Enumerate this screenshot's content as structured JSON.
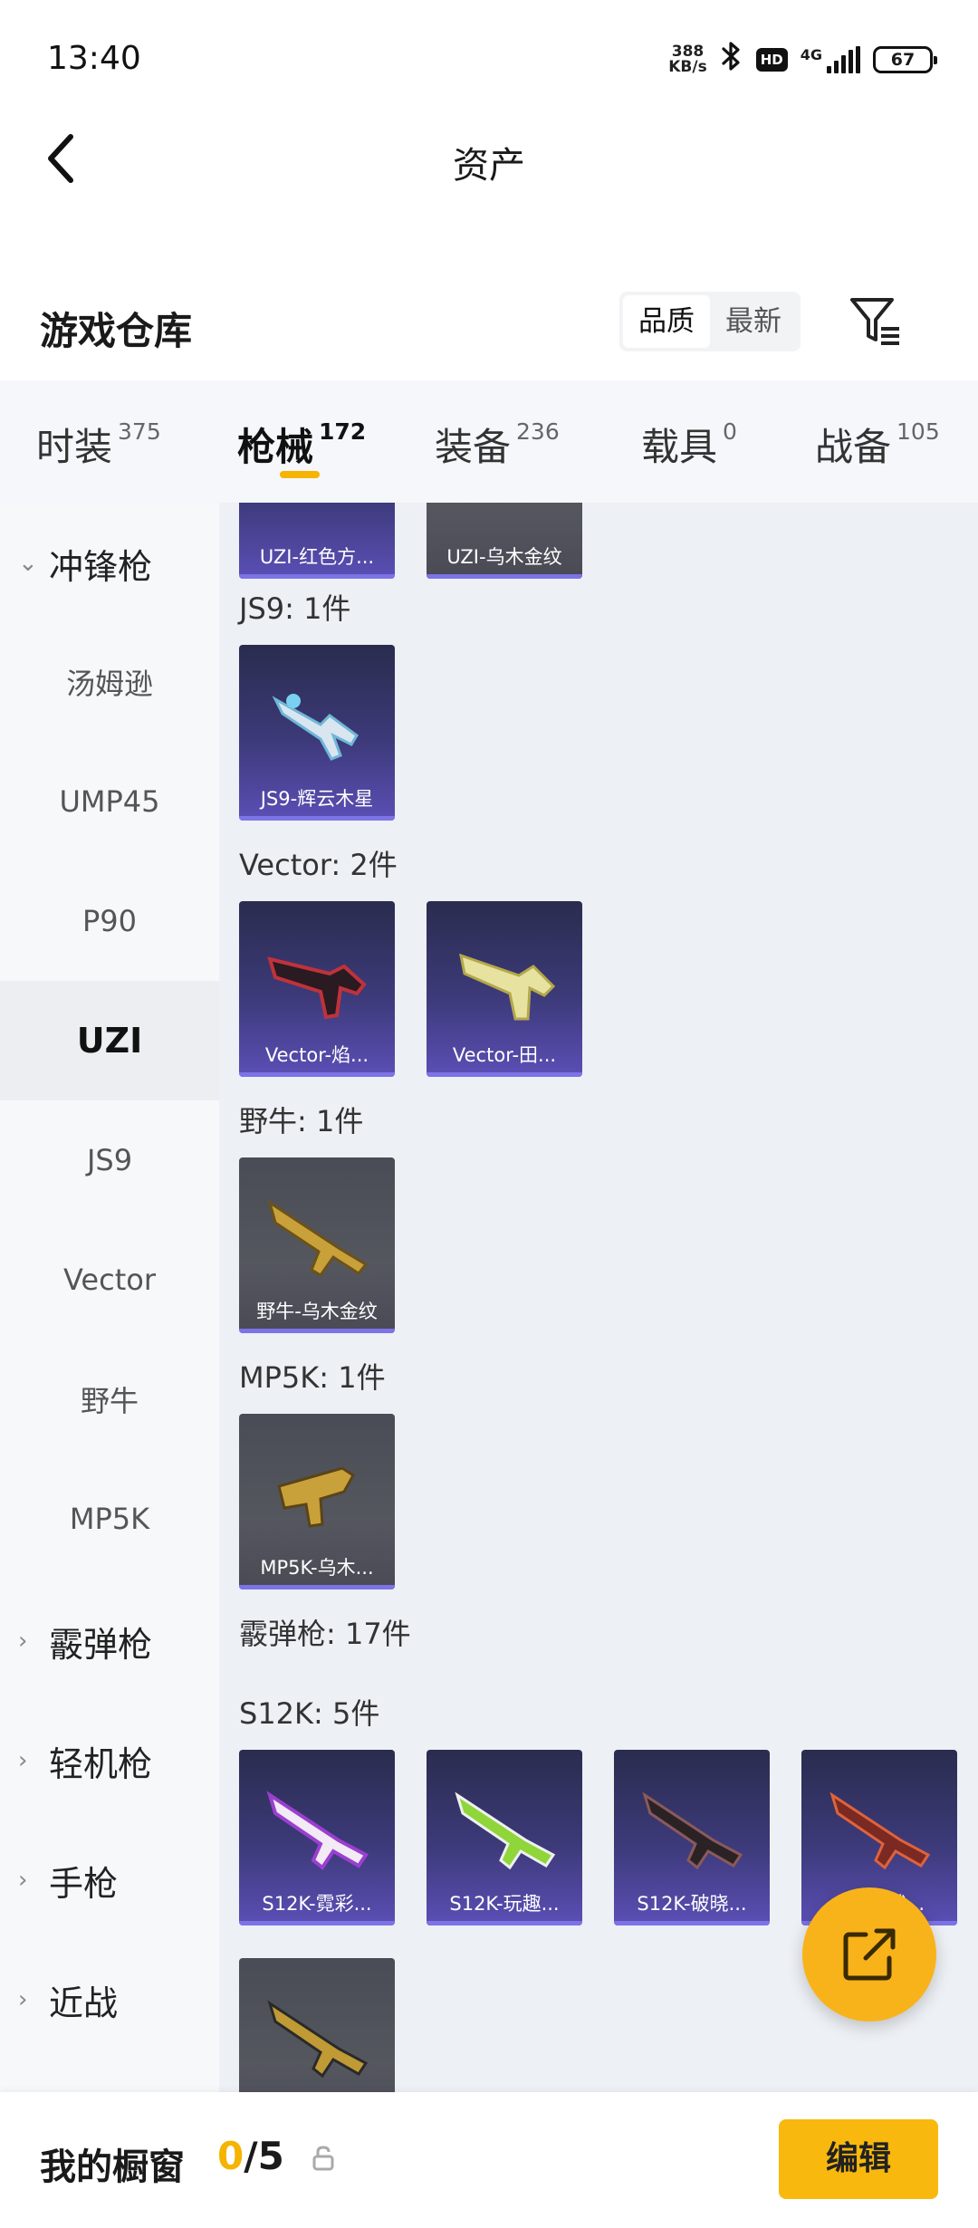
{
  "status_bar": {
    "time": "13:40",
    "net_speed_value": "388",
    "net_speed_unit": "KB/s",
    "hd_label": "HD",
    "network_label": "4G",
    "battery": "67"
  },
  "header": {
    "title": "资产"
  },
  "warehouse": {
    "title": "游戏仓库",
    "sort_options": [
      "品质",
      "最新"
    ],
    "sort_selected": "品质"
  },
  "tabs": [
    {
      "label": "时装",
      "count": "375"
    },
    {
      "label": "枪械",
      "count": "172",
      "active": true
    },
    {
      "label": "装备",
      "count": "236"
    },
    {
      "label": "载具",
      "count": "0"
    },
    {
      "label": "战备",
      "count": "105"
    }
  ],
  "sidebar": {
    "category_smg": "冲锋枪",
    "items": [
      "汤姆逊",
      "UMP45",
      "P90",
      "UZI",
      "JS9",
      "Vector",
      "野牛",
      "MP5K"
    ],
    "active_item": "UZI",
    "categories_collapsed": [
      "霰弹枪",
      "轻机枪",
      "手枪",
      "近战"
    ]
  },
  "content": {
    "uzi_cards": [
      "UZI-红色方...",
      "UZI-乌木金纹"
    ],
    "groups": [
      {
        "label": "JS9: 1件",
        "cards": [
          "JS9-辉云木星"
        ]
      },
      {
        "label": "Vector: 2件",
        "cards": [
          "Vector-焰...",
          "Vector-田..."
        ]
      },
      {
        "label": "野牛: 1件",
        "cards": [
          "野牛-乌木金纹"
        ]
      },
      {
        "label": "MP5K: 1件",
        "cards": [
          "MP5K-乌木..."
        ]
      }
    ],
    "shotgun_label": "霰弹枪: 17件",
    "s12k": {
      "label": "S12K: 5件",
      "cards": [
        "S12K-霓彩...",
        "S12K-玩趣...",
        "S12K-破晓...",
        "S12K-战..."
      ]
    }
  },
  "bottom": {
    "showcase_label": "我的橱窗",
    "showcase_current": "0",
    "showcase_total": "/5",
    "edit_label": "编辑"
  },
  "colors": {
    "accent": "#f5b400",
    "card_purple": "#3d3a7a",
    "card_gray": "#4a4c55"
  },
  "icons": [
    "back-arrow-icon",
    "bluetooth-icon",
    "filter-icon",
    "share-icon",
    "lock-icon",
    "chevron-down-icon",
    "chevron-right-icon"
  ]
}
